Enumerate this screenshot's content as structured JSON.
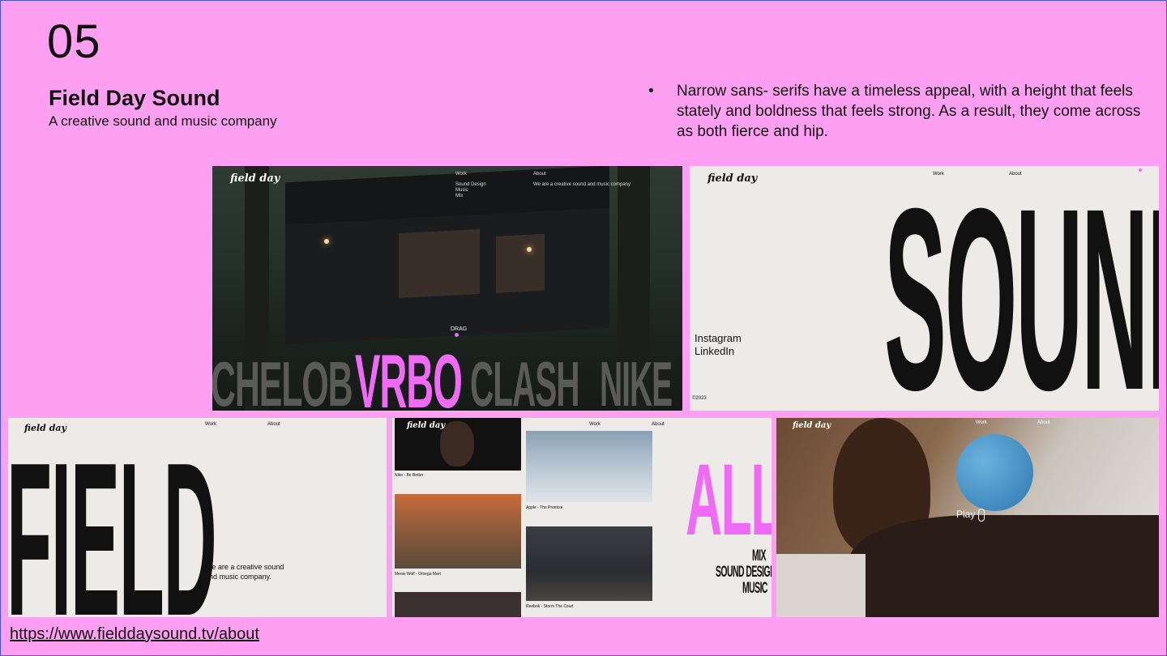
{
  "slide": {
    "number": "05",
    "title": "Field Day Sound",
    "subtitle": "A creative sound and music company",
    "bullet": "•",
    "note": "Narrow sans- serifs have a timeless appeal, with a height that feels stately and boldness that feels strong. As a result, they come across as both fierce and hip.",
    "url": "https://www.fielddaysound.tv/about"
  },
  "colors": {
    "background": "#ff9ff2",
    "accent": "#f06bf5",
    "border": "#4a56d6"
  },
  "shot1": {
    "logo": "field day",
    "nav_work": "Work",
    "nav_about": "About",
    "menu": [
      "Sound Design",
      "Music",
      "Mix"
    ],
    "tagline": "We are a creative sound and music company",
    "drag": "DRAG",
    "brands": [
      "CHELOB",
      "VRBO",
      "CLASH",
      "NIKE"
    ]
  },
  "shot2": {
    "logo": "field day",
    "nav_work": "Work",
    "nav_about": "About",
    "big": "SOUND",
    "link1": "Instagram",
    "link2": "LinkedIn",
    "copyright": "©2023"
  },
  "shot3": {
    "logo": "field day",
    "nav_work": "Work",
    "nav_about": "About",
    "big": "FIELD",
    "desc1": "We are a creative sound",
    "desc2": "and music company."
  },
  "shot4": {
    "logo": "field day",
    "nav_work": "Work",
    "nav_about": "About",
    "cap1": "Nike - Be Better",
    "cap2": "Apple - The Promise",
    "cap3": "Meow Wolf - Omega Mart",
    "cap4": "Reebok - Storm The Court",
    "big": "ALL",
    "cats": [
      "MIX",
      "SOUND DESIGN",
      "MUSIC"
    ]
  },
  "shot5": {
    "logo": "field day",
    "nav_work": "Work",
    "nav_about": "About",
    "play": "Play"
  }
}
